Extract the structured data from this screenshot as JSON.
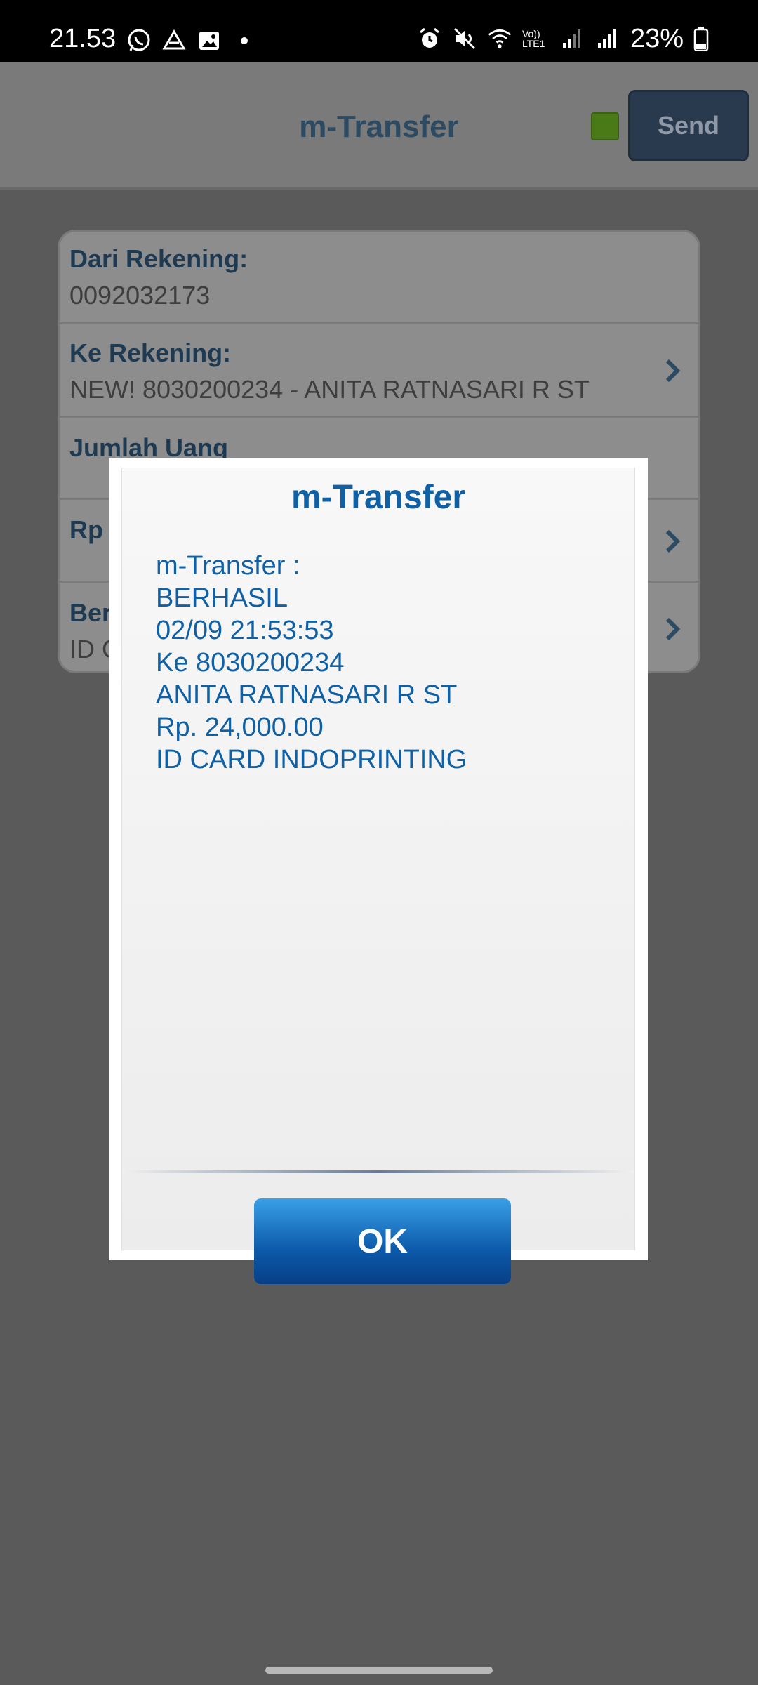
{
  "status_bar": {
    "time": "21.53",
    "battery_percent": "23%",
    "left_icons": [
      "whatsapp-icon",
      "drive-icon",
      "gallery-icon",
      "dot-icon"
    ],
    "right_icons": [
      "alarm-icon",
      "mute-icon",
      "wifi-icon",
      "volte-icon",
      "signal-icon",
      "signal-icon",
      "battery-icon"
    ],
    "volte_label": "Vo)) LTE1"
  },
  "header": {
    "title": "m-Transfer",
    "send_label": "Send",
    "status_color": "#4a7a18"
  },
  "form": {
    "from_label": "Dari Rekening:",
    "from_value": "0092032173",
    "to_label": "Ke Rekening:",
    "to_value": "NEW! 8030200234 - ANITA RATNASARI R ST",
    "amount_label": "Jumlah Uang",
    "rp_label": "Rp",
    "note_label": "Ber",
    "note_value": "ID C"
  },
  "dialog": {
    "title": "m-Transfer",
    "lines": [
      "m-Transfer :",
      "BERHASIL",
      "02/09 21:53:53",
      "Ke 8030200234",
      "ANITA RATNASARI R ST",
      "Rp. 24,000.00",
      "ID CARD INDOPRINTING"
    ],
    "ok_label": "OK"
  },
  "colors": {
    "accent": "#1060a6",
    "overlay": "#5a5a5a"
  }
}
